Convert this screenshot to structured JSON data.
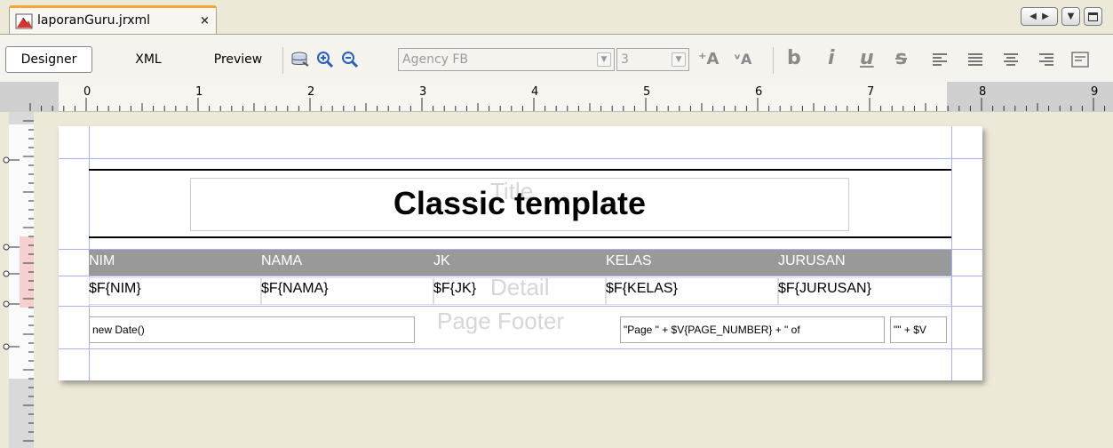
{
  "tab": {
    "label": "laporanGuru.jrxml",
    "close": "×"
  },
  "toolbar": {
    "modes": [
      "Designer",
      "XML",
      "Preview"
    ],
    "font_family": "Agency FB",
    "font_size": "3"
  },
  "ruler": {
    "labels": [
      "0",
      "1",
      "2",
      "3",
      "4",
      "5",
      "6",
      "7",
      "8",
      "9"
    ]
  },
  "report": {
    "title": "Classic template",
    "band_labels": {
      "title": "Title",
      "detail": "Detail",
      "page_footer": "Page Footer"
    },
    "columns": [
      {
        "header": "NIM",
        "field": "$F{NIM}"
      },
      {
        "header": "NAMA",
        "field": "$F{NAMA}"
      },
      {
        "header": "JK",
        "field": "$F{JK}"
      },
      {
        "header": "KELAS",
        "field": "$F{KELAS}"
      },
      {
        "header": "JURUSAN",
        "field": "$F{JURUSAN}"
      }
    ],
    "footer": {
      "date": "new Date()",
      "page_expr": "\"Page \" + $V{PAGE_NUMBER} + \" of",
      "total_expr": "\"\" + $V"
    }
  },
  "colors": {
    "tab_accent": "#f2a33a",
    "header_band": "#999999",
    "guide": "#aab0ee"
  }
}
